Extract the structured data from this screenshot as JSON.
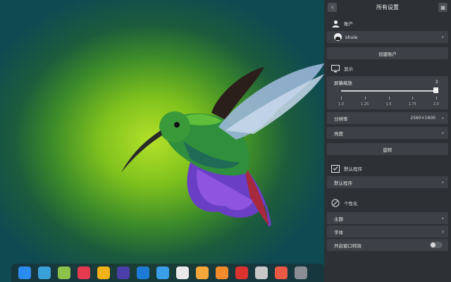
{
  "settings": {
    "title": "所有设置",
    "account": {
      "header": "账户",
      "user_name": "shule",
      "create_label": "创建账户"
    },
    "display": {
      "header": "显示",
      "scale_label": "屏幕缩放",
      "scale_value": "2",
      "scale_ticks": [
        "1.0",
        "1.25",
        "1.5",
        "1.75",
        "2.0"
      ],
      "resolution_label": "分辨率",
      "resolution_value": "2560×1600",
      "brightness_label": "亮度",
      "rotate_label": "旋转"
    },
    "default_apps": {
      "header": "默认程序",
      "item_label": "默认程序"
    },
    "personalization": {
      "header": "个性化",
      "theme_label": "主题",
      "font_label": "字体",
      "window_effect_label": "开启窗口特效",
      "window_effect_on": false
    }
  },
  "dock_apps": [
    {
      "name": "launcher",
      "color": "#2a8cf0"
    },
    {
      "name": "file-manager",
      "color": "#3aa0d8"
    },
    {
      "name": "music",
      "color": "#8bc34a"
    },
    {
      "name": "app-store",
      "color": "#e53950"
    },
    {
      "name": "chrome",
      "color": "#f2b31a"
    },
    {
      "name": "system-monitor",
      "color": "#4a3fa8"
    },
    {
      "name": "video-player",
      "color": "#1d7bd8"
    },
    {
      "name": "browser",
      "color": "#3a9ee8"
    },
    {
      "name": "draw",
      "color": "#e9e9e9"
    },
    {
      "name": "image-viewer",
      "color": "#f4a73a"
    },
    {
      "name": "archive",
      "color": "#f08a2a"
    },
    {
      "name": "terminal",
      "color": "#d9322f"
    },
    {
      "name": "settings",
      "color": "#c8c8c8"
    },
    {
      "name": "screen-recorder",
      "color": "#e85a44"
    },
    {
      "name": "dev-tools",
      "color": "#8a8f95"
    }
  ]
}
